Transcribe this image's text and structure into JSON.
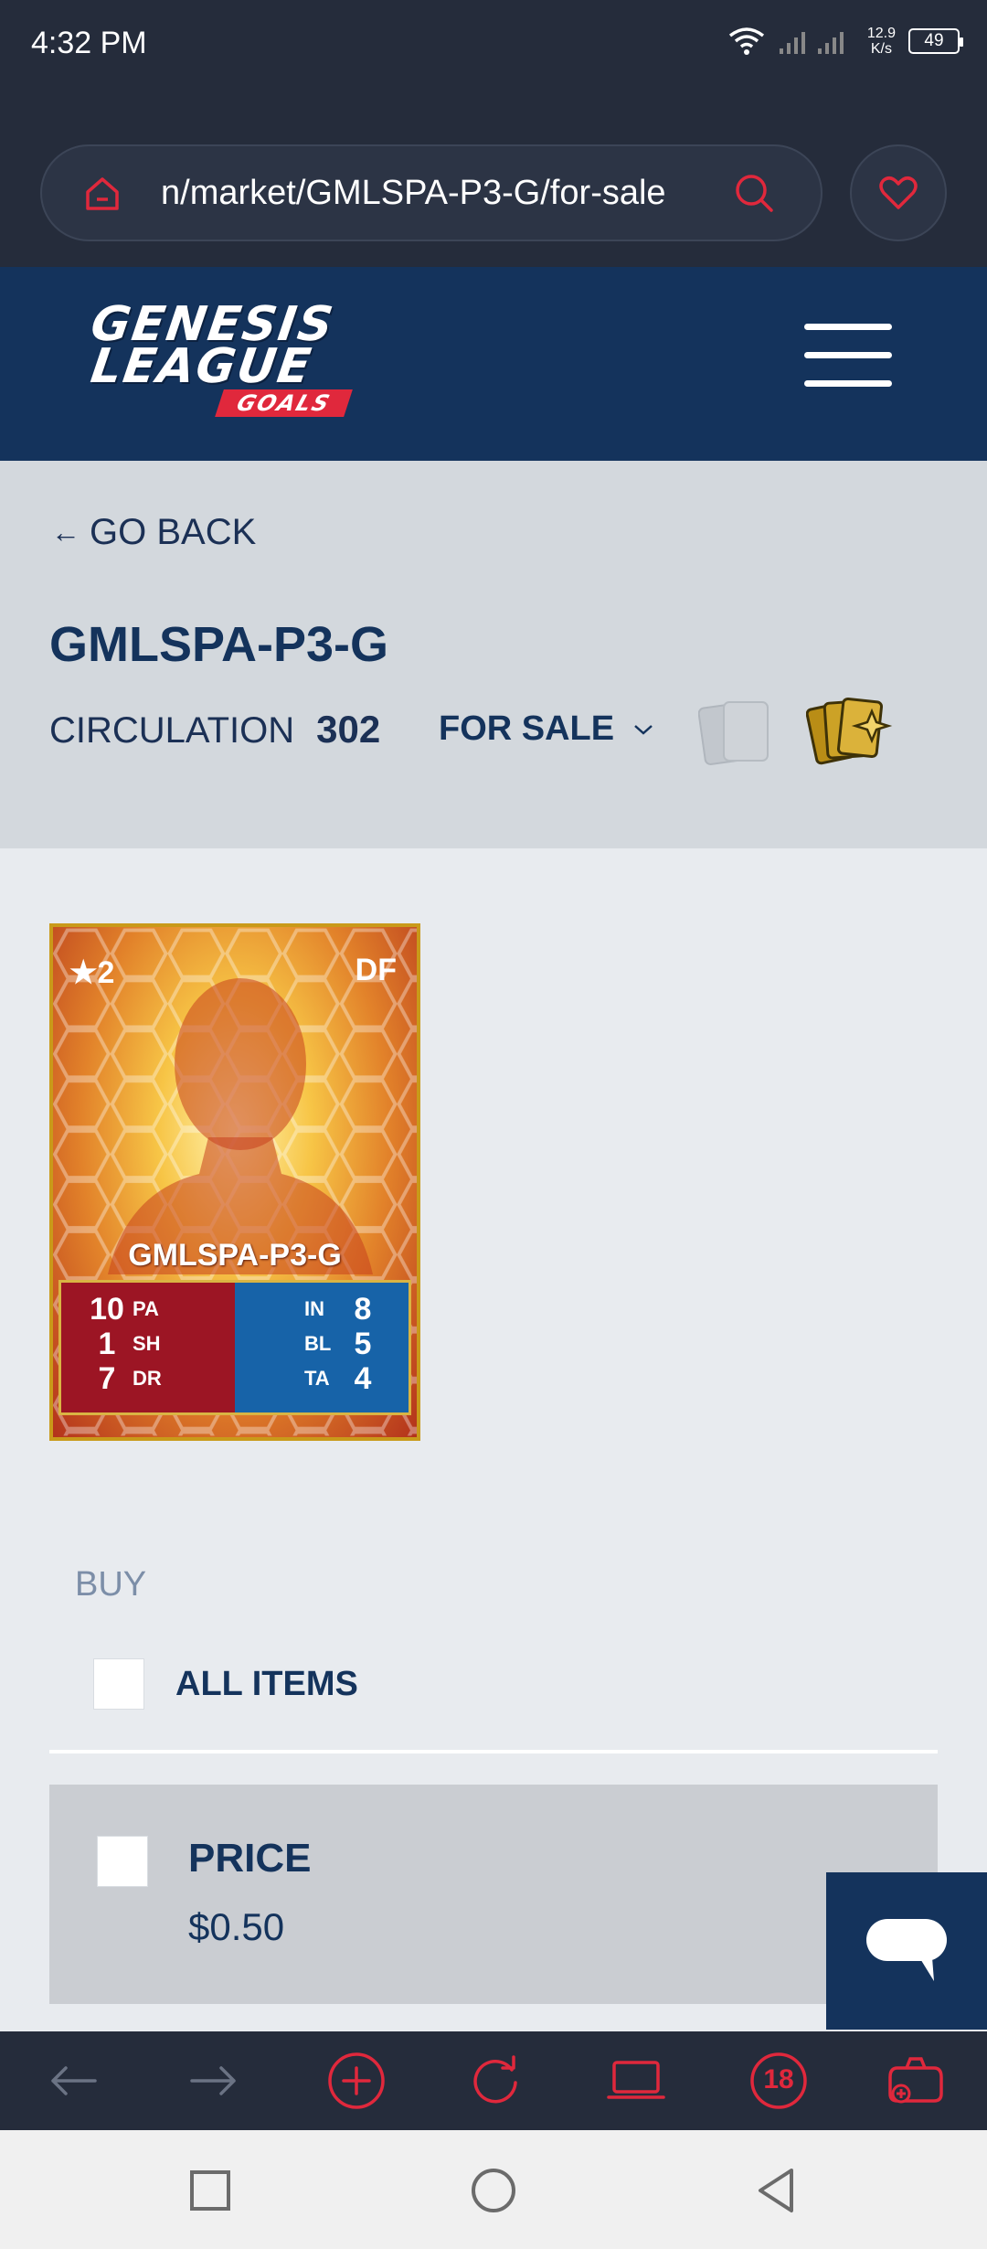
{
  "status_bar": {
    "time": "4:32 PM",
    "net_speed_value": "12.9",
    "net_speed_unit": "K/s",
    "battery": "49"
  },
  "browser": {
    "url": "n/market/GMLSPA-P3-G/for-sale",
    "tabs_count": "18"
  },
  "header": {
    "logo_line1": "GENESIS",
    "logo_line2": "LEAGUE",
    "logo_sub": "GOALS"
  },
  "title_section": {
    "go_back": "GO BACK",
    "card_id": "GMLSPA-P3-G",
    "circulation_label": "CIRCULATION",
    "circulation_value": "302",
    "filter_label": "FOR SALE"
  },
  "card": {
    "stars": "2",
    "position": "DF",
    "name": "GMLSPA-P3-G",
    "stats_left": [
      {
        "value": "10",
        "label": "PA"
      },
      {
        "value": "1",
        "label": "SH"
      },
      {
        "value": "7",
        "label": "DR"
      }
    ],
    "stats_right": [
      {
        "value": "8",
        "label": "IN"
      },
      {
        "value": "5",
        "label": "BL"
      },
      {
        "value": "4",
        "label": "TA"
      }
    ]
  },
  "buy": {
    "label": "BUY",
    "all_items_label": "ALL ITEMS",
    "price_label": "PRICE",
    "price_value": "$0.50"
  },
  "colors": {
    "navy": "#14335c",
    "accent_red": "#e0283c",
    "browser_dark": "#252c3b",
    "gold": "#c99a1a"
  }
}
